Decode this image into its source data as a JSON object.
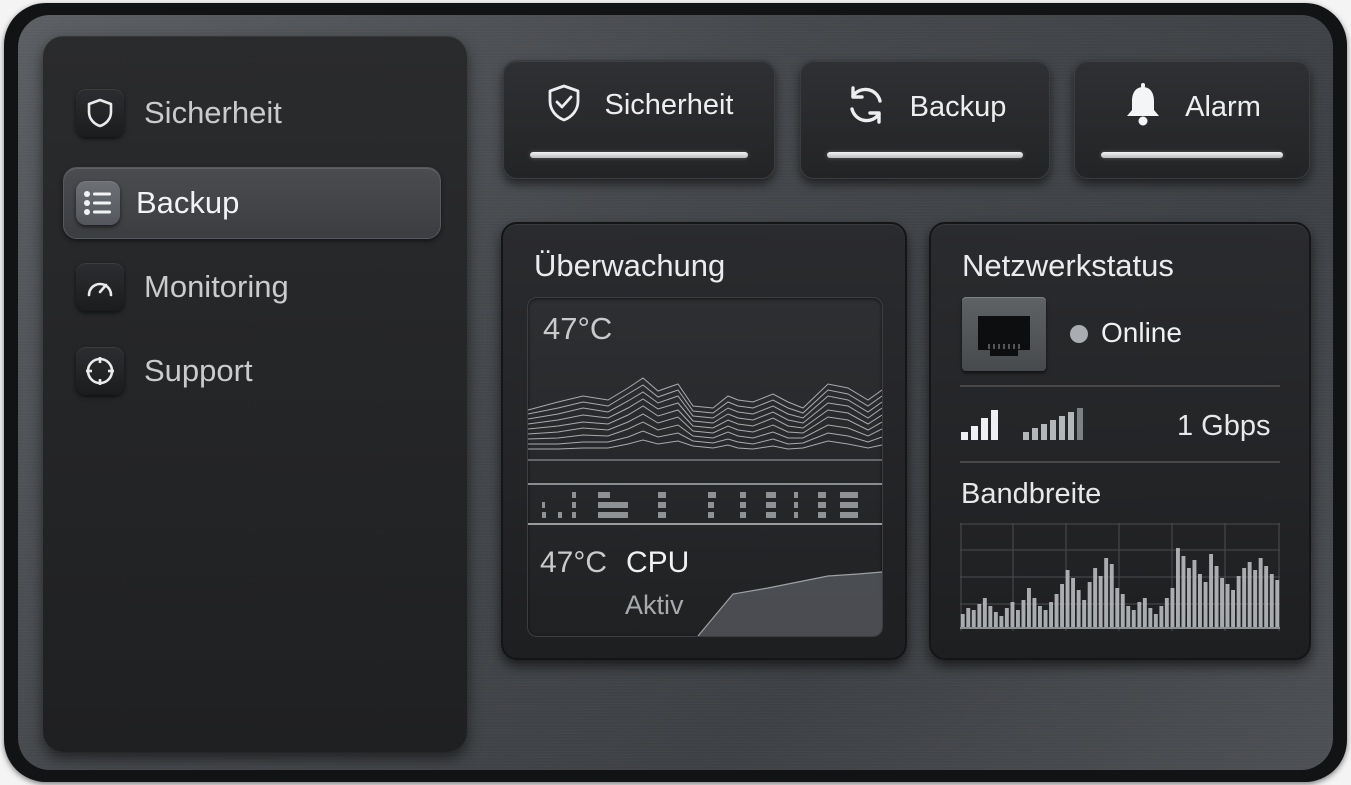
{
  "sidebar": {
    "items": [
      {
        "label": "Sicherheit",
        "icon": "shield-icon",
        "active": false
      },
      {
        "label": "Backup",
        "icon": "list-icon",
        "active": true
      },
      {
        "label": "Monitoring",
        "icon": "gauge-icon",
        "active": false
      },
      {
        "label": "Support",
        "icon": "lifebuoy-icon",
        "active": false
      }
    ]
  },
  "top_buttons": [
    {
      "label": "Sicherheit",
      "icon": "shield-check-icon"
    },
    {
      "label": "Backup",
      "icon": "refresh-icon"
    },
    {
      "label": "Alarm",
      "icon": "bell-icon"
    }
  ],
  "monitoring": {
    "title": "Überwachung",
    "temp_top": "47°C",
    "temp_bottom": "47°C",
    "cpu_label": "CPU",
    "cpu_status": "Aktiv"
  },
  "network": {
    "title": "Netzwerkstatus",
    "status": "Online",
    "speed": "1 Gbps",
    "bandwidth_title": "Bandbreite",
    "status_color": "#a9adb1"
  }
}
